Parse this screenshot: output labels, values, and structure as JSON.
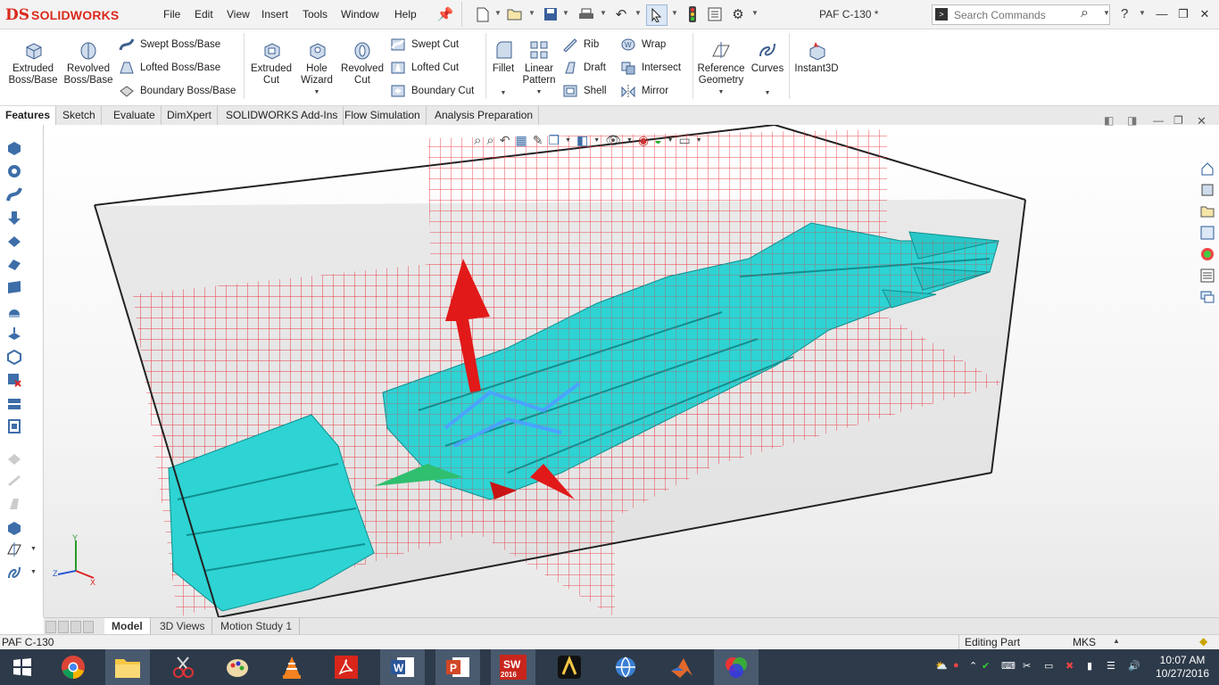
{
  "app": {
    "logo_ds": "DS",
    "logo_name": "SOLIDWORKS",
    "doc_title": "PAF C-130 *"
  },
  "menu": [
    "File",
    "Edit",
    "View",
    "Insert",
    "Tools",
    "Window",
    "Help"
  ],
  "search": {
    "placeholder": "Search Commands"
  },
  "help_label": "?",
  "command_manager": {
    "extruded_boss": "Extruded Boss/Base",
    "revolved_boss": "Revolved Boss/Base",
    "swept_boss": "Swept Boss/Base",
    "lofted_boss": "Lofted Boss/Base",
    "boundary_boss": "Boundary Boss/Base",
    "extruded_cut": "Extruded Cut",
    "hole_wizard": "Hole Wizard",
    "revolved_cut": "Revolved Cut",
    "swept_cut": "Swept Cut",
    "lofted_cut": "Lofted Cut",
    "boundary_cut": "Boundary Cut",
    "fillet": "Fillet",
    "linear_pattern": "Linear Pattern",
    "rib": "Rib",
    "draft": "Draft",
    "shell": "Shell",
    "wrap": "Wrap",
    "intersect": "Intersect",
    "mirror": "Mirror",
    "reference_geometry": "Reference Geometry",
    "curves": "Curves",
    "instant3d": "Instant3D"
  },
  "tabs": [
    "Features",
    "Sketch",
    "Evaluate",
    "DimXpert",
    "SOLIDWORKS Add-Ins",
    "Flow Simulation",
    "Analysis Preparation"
  ],
  "bottom_tabs": [
    "Model",
    "3D Views",
    "Motion Study 1"
  ],
  "status": {
    "left": "PAF C-130",
    "mode": "Editing Part",
    "units": "MKS"
  },
  "triad": {
    "x": "X",
    "y": "Y",
    "z": "Z"
  },
  "clock": {
    "time": "10:07 AM",
    "date": "10/27/2016"
  },
  "taskbar_badge": "2016",
  "colors": {
    "accent_red": "#da291c",
    "model_cyan": "#2ed3d3",
    "grid_red": "#e8303a",
    "taskbar": "#2d3a4a"
  }
}
